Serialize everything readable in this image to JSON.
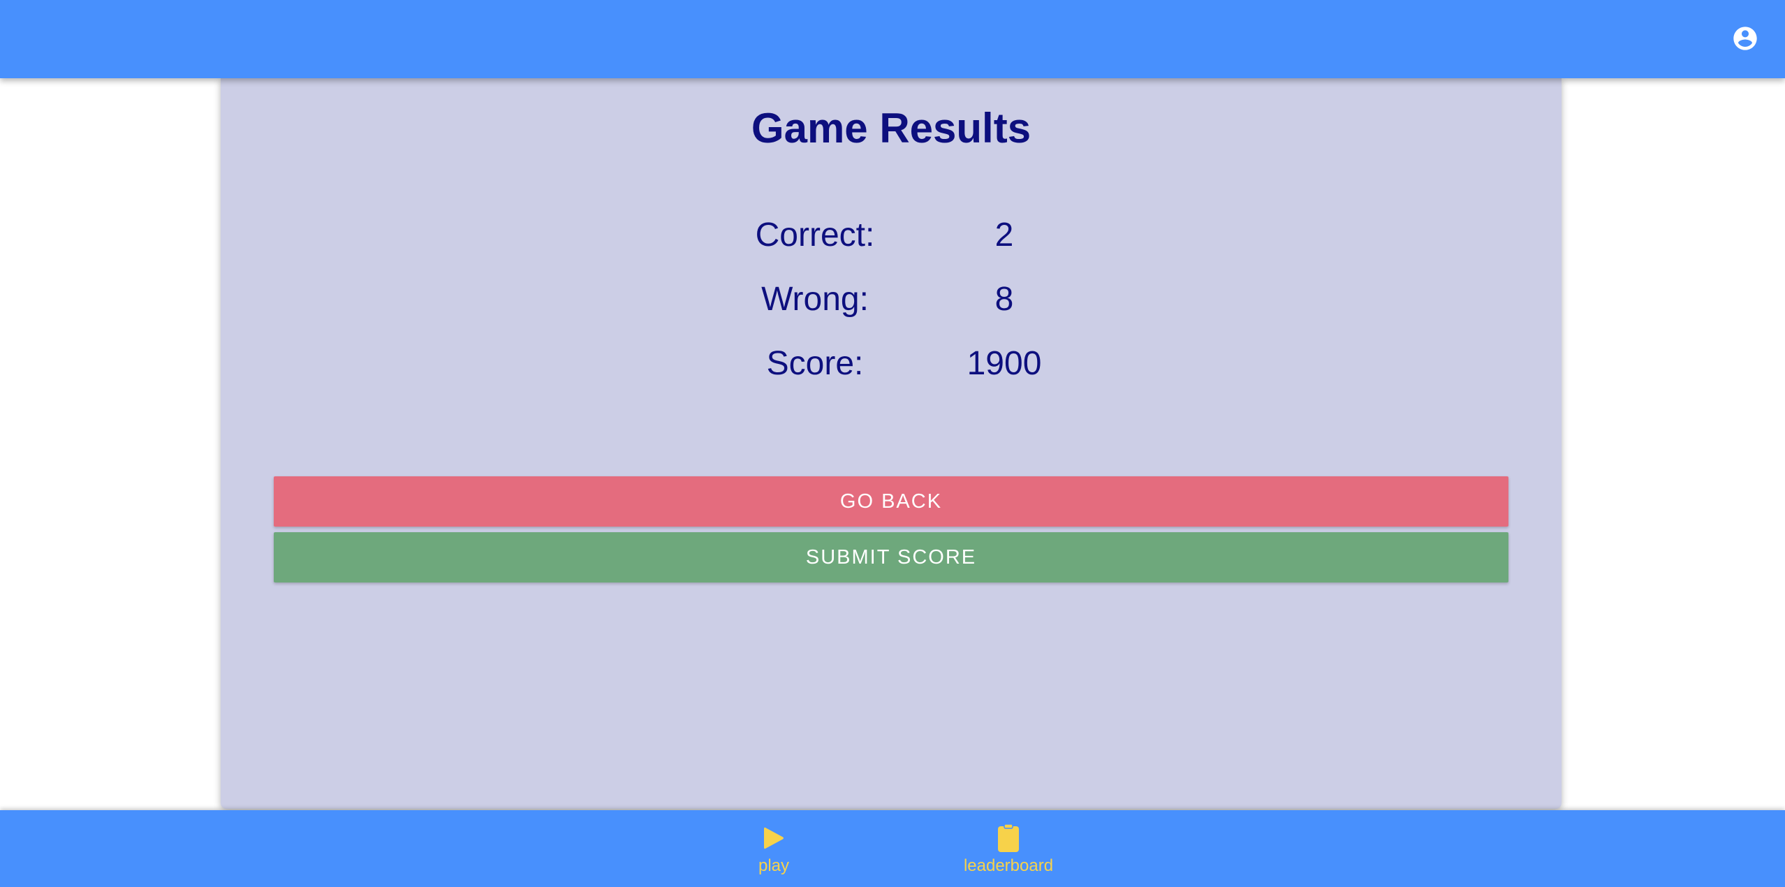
{
  "header": {
    "account_icon": "account-circle-icon",
    "background": "#4890fd"
  },
  "results": {
    "title": "Game Results",
    "stats": [
      {
        "label": "Correct:",
        "value": "2"
      },
      {
        "label": "Wrong:",
        "value": "8"
      },
      {
        "label": "Score:",
        "value": "1900"
      }
    ],
    "text_color": "#0d0f7e",
    "card_background": "#cccee6"
  },
  "actions": {
    "go_back_label": "GO BACK",
    "go_back_color": "#e46c7e",
    "submit_score_label": "SUBMIT SCORE",
    "submit_score_color": "#6ea87c"
  },
  "bottom_nav": {
    "items": [
      {
        "label": "play",
        "icon": "play-icon"
      },
      {
        "label": "leaderboard",
        "icon": "clipboard-icon"
      }
    ],
    "accent_color": "#f7d24a"
  }
}
